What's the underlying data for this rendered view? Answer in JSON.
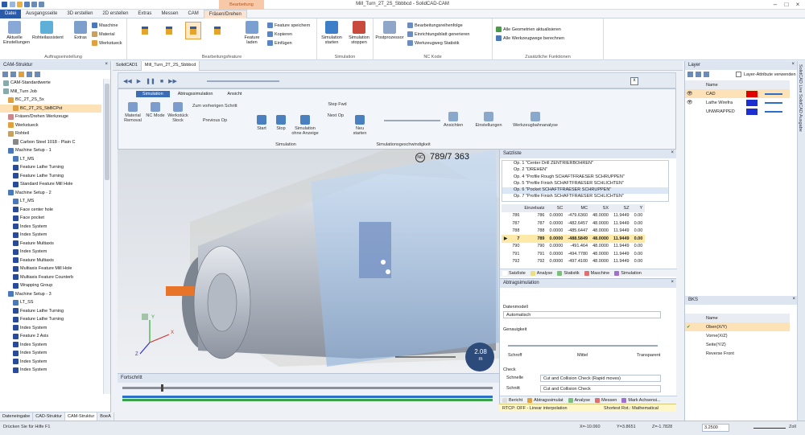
{
  "window": {
    "title": "Mill_Turn_2T_2S_Sbbbcd - SolidCAD-CAM",
    "context_tab": "Bearbeitung"
  },
  "ribbon_tabs": [
    "Datei",
    "Ausgangsseite",
    "3D erstellen",
    "2D erstellen",
    "Extras",
    "Messen",
    "CAM",
    "Fräsen/Drehen"
  ],
  "ribbon": {
    "groups": [
      "Auftragseinstellung",
      "Bearbeitungsfeature",
      "Simulation",
      "NC Kode",
      "Zusätzliche Funktionen"
    ],
    "aktuelle": "Aktuelle Einstellungen",
    "rohteil": "Rohteilassistent",
    "extras": "Extras",
    "maschine": "Maschine",
    "material": "Material",
    "werkstueck": "Werkstueck",
    "feature_laden": "Feature laden",
    "feature_speichern": "Feature speichern",
    "kopieren": "Kopieren",
    "einfuegen": "Einfügen",
    "sim_starten": "Simulation starten",
    "sim_stoppen": "Simulation stoppen",
    "postprozessor": "Postprozessor",
    "reihenfolge": "Bearbeitungsreihenfolge",
    "einrichtung": "Einrichtungsblatt generieren",
    "werkzeugstat": "Werkzeugweg Statistik",
    "geom": "Alle Geometrien aktualisieren",
    "wege": "Alle Werkzeugwege berechnen"
  },
  "left": {
    "title": "CAM-Struktur",
    "tree": [
      "CAM-Standardwerte",
      "Mill_Turn Job",
      "BC_2T_2S_5x",
      "BC_2T_2S_SbBCPst",
      "Fräsen/Drehen Werkzeuge",
      "Werkstueck",
      "Rohteil",
      "Carbon Steel 1018 - Plain C",
      "Machine Setup - 1",
      "LT_MS",
      "Feature Lathe Turning",
      "Feature Lathe Turning",
      "Standard Feature Mill Hole",
      "Machine Setup - 2",
      "LT_MS",
      "Face center hole",
      "Face pocket",
      "Index System",
      "Index System",
      "Feature Multiaxis",
      "Index System",
      "Feature Multiaxis",
      "Multiaxis Feature Mill Hole",
      "Multiaxis Feature Counterb",
      "Wrapping Group",
      "Machine Setup - 3",
      "LT_SS",
      "Feature Lathe Turning",
      "Feature Lathe Turning",
      "Index System",
      "Feature 2 Axis",
      "Index System",
      "Index System",
      "Index System",
      "Index System"
    ],
    "tabs": [
      "Dateneingabe",
      "CAD-Struktur",
      "CAM-Struktur",
      "BoeA"
    ]
  },
  "doctabs": [
    "SolidCAD1",
    "Mill_Turn_2T_2S_Sbbbcd"
  ],
  "sim": {
    "tabs": [
      "Simulation",
      "Abtragssimulation",
      "Ansicht"
    ],
    "material": "Material Removal",
    "nc_mode": "NC Mode",
    "werkstueck": "Werkstück Stock",
    "prev_step": "Zum vorherigen Schritt",
    "prev_op": "Previous Op",
    "start": "Start",
    "stop": "Stop",
    "sim_eine": "Simulation ohne Anzeige",
    "step_fwd": "Step Fwd",
    "next_op": "Next Op",
    "neu": "Neu starten",
    "group_sim": "Simulation",
    "group_speed": "Simulationsgeschwindigkeit",
    "ansichten": "Ansichten",
    "einstellungen": "Einstellungen",
    "werkzeugbahnanalyse": "Werkzeugbahnanalyse"
  },
  "viewport": {
    "block": "789/7 363",
    "nc": "NC",
    "time": "2.08",
    "time_unit": "m",
    "axis_x": "X",
    "axis_y": "Y",
    "axis_z": "Z"
  },
  "satz": {
    "title": "Satzliste",
    "ops": [
      "Op. 1 \"Center Drill ZENTRIERBOHREN\"",
      "Op. 2 \"DREHEN\"",
      "Op. 4 \"Profile Rough SCHAFTFRAESER SCHRUPPEN\"",
      "Op. 5 \"Profile Finish SCHAFTFRAESER SCHLICHTEN\"",
      "Op. 6 \"Pocket SCHAFTFRAESER SCHRUPPEN\"",
      "Op. 7 \"Profile Finish SCHAFTFRAESER SCHLICHTEN\""
    ],
    "headers": [
      "",
      "",
      "Einzelsatz",
      "SC",
      "MC",
      "SX",
      "SZ",
      "Y"
    ],
    "rows": [
      [
        "",
        "786",
        "786",
        "0.0000",
        "-479.6360",
        "48.0000",
        "11.9449",
        "0.00"
      ],
      [
        "",
        "787",
        "787",
        "0.0000",
        "-482.6457",
        "48.0000",
        "11.9449",
        "0.00"
      ],
      [
        "",
        "788",
        "788",
        "0.0000",
        "-485.6447",
        "48.0000",
        "11.9449",
        "0.00"
      ],
      [
        "▶",
        "7",
        "789",
        "0.0000",
        "-488.5849",
        "48.0000",
        "11.9449",
        "0.00"
      ],
      [
        "",
        "790",
        "790",
        "0.0000",
        "-491.464",
        "48.0000",
        "11.9449",
        "0.00"
      ],
      [
        "",
        "791",
        "791",
        "0.0000",
        "-494.7780",
        "48.0000",
        "11.9449",
        "0.00"
      ],
      [
        "",
        "792",
        "792",
        "0.0000",
        "-497.4100",
        "48.0000",
        "11.9449",
        "0.00"
      ]
    ],
    "tabs": [
      "Satzliste",
      "Analyse",
      "Statistik",
      "Maschine",
      "Simulation"
    ]
  },
  "abtrag": {
    "title": "Abtragsimulation",
    "datenmodell": "Datenmodell",
    "automatisch": "Automatisch",
    "genauigkeit": "Genauigkeit",
    "schroff": "Schroff",
    "mittel": "Mittel",
    "transparent": "Transparent",
    "check": "Check",
    "schnelle": "Schnelle",
    "schnelle_val": "Cut and Collision Check (Rapid moves)",
    "schnitt": "Schnitt",
    "schnitt_val": "Cut and Collision Check",
    "tabs": [
      "Bericht",
      "Abtragssimulat",
      "Analyse",
      "Messen",
      "Mark Achsensi..."
    ]
  },
  "fortschritt": {
    "title": "Fortschritt"
  },
  "status": {
    "rtcp": "RTCP: OFF - Linear interpolation",
    "shortest": "Shortest Rot.: Mathematical",
    "hint": "Drücken Sie für Hilfe F1",
    "x": "X=-10.060",
    "y": "Y=3.8651",
    "z": "Z=-1.7828",
    "zoom": "3.2500",
    "zoomlabel": "Zoll"
  },
  "right": {
    "layer_title": "Layer",
    "layer_attr": "Layer-Attribute verwenden",
    "layer_header": "Name",
    "layers": [
      {
        "name": "CAD",
        "color": "#e00000",
        "on": true
      },
      {
        "name": "Lathe Wirefra",
        "color": "#1d2fd1",
        "on": true
      },
      {
        "name": "UNWRAPPED",
        "color": "#1d2fd1",
        "on": false
      }
    ],
    "bks_title": "BKS",
    "bks_header": "Name",
    "bks": [
      "Oben(X/Y)",
      "Vorne(X/Z)",
      "Seite(Y/Z)",
      "Reverse Front"
    ],
    "strip": "SolidCAD Live  SolidCAD Ausgabe"
  }
}
